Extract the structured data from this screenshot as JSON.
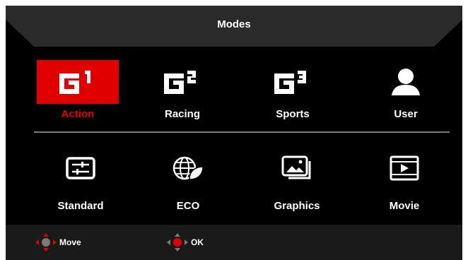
{
  "header": {
    "title": "Modes"
  },
  "game_modes": [
    {
      "label": "Action",
      "icon": "g1-icon",
      "superscript": "1",
      "selected": true
    },
    {
      "label": "Racing",
      "icon": "g2-icon",
      "superscript": "2",
      "selected": false
    },
    {
      "label": "Sports",
      "icon": "g3-icon",
      "superscript": "3",
      "selected": false
    },
    {
      "label": "User",
      "icon": "user-icon",
      "selected": false
    }
  ],
  "picture_modes": [
    {
      "label": "Standard",
      "icon": "sliders-icon"
    },
    {
      "label": "ECO",
      "icon": "globe-leaf-icon"
    },
    {
      "label": "Graphics",
      "icon": "image-stack-icon"
    },
    {
      "label": "Movie",
      "icon": "film-play-icon"
    }
  ],
  "footer": {
    "move_label": "Move",
    "ok_label": "OK"
  },
  "colors": {
    "accent": "#e00000",
    "background": "#000000",
    "header_bg": "#2a2a2a",
    "text": "#ffffff"
  }
}
